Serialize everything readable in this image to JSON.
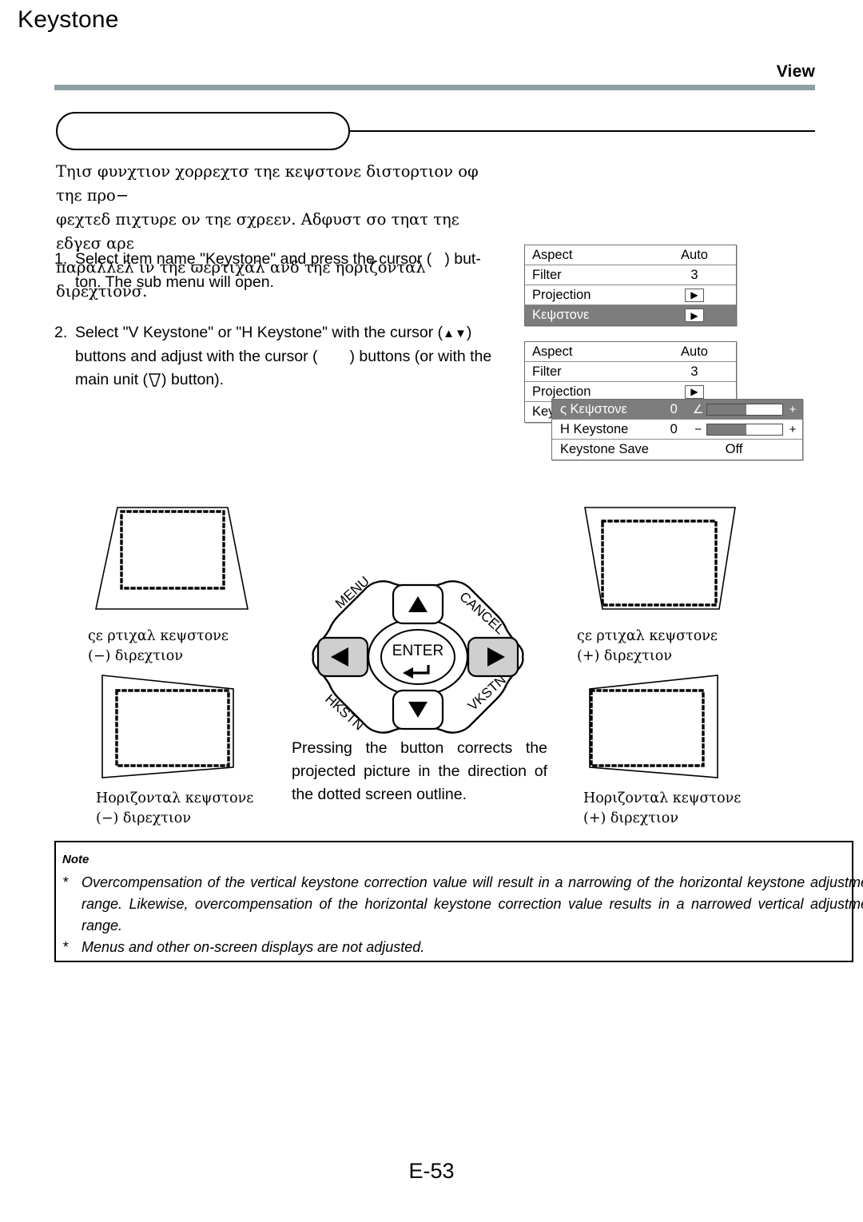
{
  "header": {
    "section_label": "View"
  },
  "title": {
    "text": "Keystone"
  },
  "intro": {
    "line1": "Τηισ φυνχτιον χορρεχτσ τηε κεψστονε διστορτιον οφ τηε προ−",
    "line2": "φεχτεδ πιχτυρε ον τηε σχρεεν. Αδφυστ σο τηατ τηε εδγεσ αρε",
    "line3": "παραλλελ ιν τηε ϖερτιχαλ ανδ τηε ηοριζονταλ διρεχτιονσ."
  },
  "steps": [
    {
      "number": "1.",
      "part1": "Select item name \"Keystone\" and press the cursor (",
      "part2": ") but-",
      "part3": "ton. The sub menu will open."
    },
    {
      "number": "2.",
      "part1": "Select \"V Keystone\" or \"H Keystone\" with the cursor (",
      "part2": ")",
      "part3": "buttons and adjust with the cursor (",
      "part4": ") buttons (or with the",
      "part5": "main unit (",
      "part6": ") button)."
    }
  ],
  "osd_menu_1": {
    "rows": [
      {
        "label": "Aspect",
        "value": "Auto",
        "type": "value",
        "selected": false
      },
      {
        "label": "Filter",
        "value": "3",
        "type": "value",
        "selected": false
      },
      {
        "label": "Projection",
        "value": "▶",
        "type": "arrow",
        "selected": false
      },
      {
        "label": "Κεψστονε",
        "value": "▶",
        "type": "arrow",
        "selected": true
      }
    ]
  },
  "osd_menu_2": {
    "rows": [
      {
        "label": "Aspect",
        "value": "Auto",
        "type": "value",
        "selected": false
      },
      {
        "label": "Filter",
        "value": "3",
        "type": "value",
        "selected": false
      },
      {
        "label": "Projection",
        "value": "▶",
        "type": "arrow",
        "selected": false
      },
      {
        "label": "Key",
        "value": "",
        "type": "value",
        "selected": false
      }
    ]
  },
  "osd_submenu": {
    "rows": [
      {
        "label": "ς Κεψστονε",
        "value": "0",
        "sign": "∠",
        "slider": 52,
        "plus": "+",
        "selected": true
      },
      {
        "label": "H Keystone",
        "value": "0",
        "sign": "−",
        "slider": 52,
        "plus": "+",
        "selected": false
      }
    ],
    "save_row": {
      "label": "Keystone Save",
      "value": "Off"
    }
  },
  "figures": {
    "vertical_minus": {
      "caption_line1": "ςε ρτιχαλ  κεψστονε",
      "caption_line2": "(−) διρεχτιον"
    },
    "vertical_plus": {
      "caption_line1": "ςε ρτιχαλ  κεψστονε",
      "caption_line2": "(+) διρεχτιον"
    },
    "horizontal_minus": {
      "caption_line1": "Ηοριζονταλ  κεψστονε",
      "caption_line2": "(−) διρεχτιον"
    },
    "horizontal_plus": {
      "caption_line1": "Ηοριζονταλ  κεψστονε",
      "caption_line2": "(+) διρεχτιον"
    }
  },
  "remote": {
    "menu_label": "MENU",
    "cancel_label": "CANCEL",
    "hkstn_label": "HKSTN",
    "vkstn_label": "VKSTN",
    "enter_label": "ENTER",
    "up_label": "▲",
    "down_label": "▼",
    "left_label": "◀",
    "right_label": "▶"
  },
  "center_caption": {
    "text": "Pressing the button corrects the projected picture in the direction of the dotted screen outline."
  },
  "note": {
    "title": "Note",
    "bullet": "*",
    "item1": "Overcompensation of the vertical keystone correction value will result in a narrowing of the horizontal keystone adjustment range. Likewise, overcompensation of the horizontal keystone correction value results in a narrowed vertical adjustment range.",
    "item2": "Menus and other on-screen displays are not adjusted."
  },
  "footer": {
    "page": "E-53"
  },
  "colors": {
    "header_rule": "#8d9fa3",
    "osd_selected": "#7d7d7d",
    "slider_fill": "#7b7b7b",
    "key_highlight": "#c9c9c9"
  }
}
